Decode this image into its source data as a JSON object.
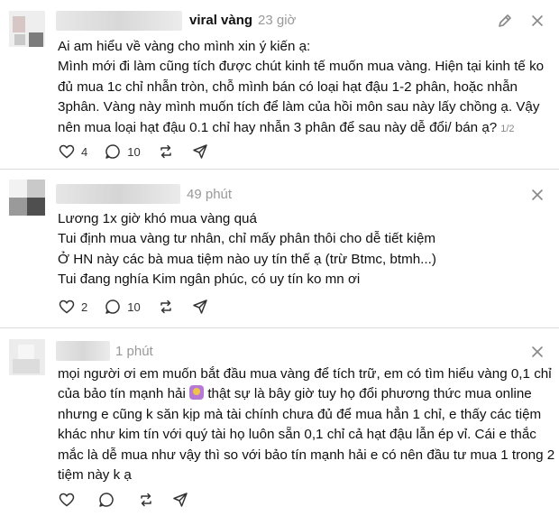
{
  "posts": [
    {
      "username": "viral vàng",
      "time": "23 giờ",
      "lines": [
        "Ai am hiểu về vàng cho mình xin ý kiến ạ:",
        "Mình mới đi làm cũng tích được chút kinh tế muốn mua vàng. Hiện tại kinh tế ko",
        "đủ mua 1c chỉ nhẫn tròn, chỗ mình bán có loại hạt đậu 1-2 phân, hoặc nhẫn",
        "3phân. Vàng này mình muốn tích để làm của hồi môn sau này lấy chồng ạ. Vậy",
        "nên mua loại hạt đậu 0.1 chỉ hay nhẫn 3 phân để sau này dễ đổi/ bán ạ?"
      ],
      "pager": "1/2",
      "likes": "4",
      "comments": "10",
      "reposts": "",
      "shares": ""
    },
    {
      "username": "",
      "time": "49 phút",
      "lines": [
        "Lương 1x giờ khó mua vàng quá",
        "Tui định mua vàng tư nhân, chỉ mấy phân thôi cho dễ tiết kiệm",
        "Ở HN này các bà mua tiệm nào uy tín thế ạ (trừ Btmc, btmh...)",
        "Tui đang nghía Kim ngân phúc, có uy tín ko mn ơi"
      ],
      "likes": "2",
      "comments": "10",
      "reposts": "",
      "shares": ""
    },
    {
      "username": "",
      "time": "1 phút",
      "lines": [
        "mọi người ơi em muốn bắt đầu mua vàng để tích trữ, em có tìm hiểu vàng 0,1 chỉ",
        "của bảo tín mạnh hải",
        " thật sự là bây giờ tuy họ đổi phương thức mua online",
        "nhưng e cũng k săn kịp mà tài chính chưa đủ để mua hẳn 1 chỉ, e thấy các tiệm",
        "khác như kim tín với quý tài họ luôn sẵn 0,1 chỉ cả hạt đậu lẫn ép vỉ. Cái e thắc",
        "mắc là dễ mua như vậy thì so với bảo tín mạnh hải e có nên đầu tư mua 1 trong 2",
        "tiệm này k ạ"
      ],
      "likes": "",
      "comments": "",
      "reposts": "",
      "shares": ""
    }
  ],
  "colors": {
    "text": "#101010",
    "muted": "#999999",
    "divider": "#d9d9d9"
  },
  "icons": [
    "edit-icon",
    "more-icon",
    "heart-icon",
    "comment-icon",
    "repost-icon",
    "share-icon",
    "emoji-sticker"
  ]
}
